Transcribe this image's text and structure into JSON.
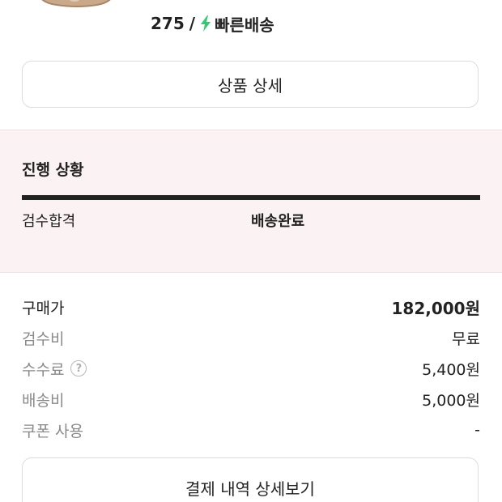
{
  "product": {
    "image_icon": "sneaker-image",
    "size": "275",
    "separator": "/",
    "shipping_icon": "lightning-bolt-icon",
    "shipping_color": "#2ecc71",
    "shipping_label": "빠른배송"
  },
  "detail_button": {
    "label": "상품 상세"
  },
  "progress": {
    "title": "진행 상황",
    "bar_fill": 1.0,
    "steps": [
      "검수합격",
      "배송완료"
    ],
    "active_step": "배송완료"
  },
  "price": {
    "rows": [
      {
        "label": "구매가",
        "value": "182,000원",
        "help": false
      },
      {
        "label": "검수비",
        "value": "무료",
        "help": false
      },
      {
        "label": "수수료",
        "value": "5,400원",
        "help": true,
        "help_glyph": "?"
      },
      {
        "label": "배송비",
        "value": "5,000원",
        "help": false
      },
      {
        "label": "쿠폰 사용",
        "value": "-",
        "help": false
      }
    ]
  },
  "payment_button": {
    "label": "결제 내역 상세보기"
  }
}
